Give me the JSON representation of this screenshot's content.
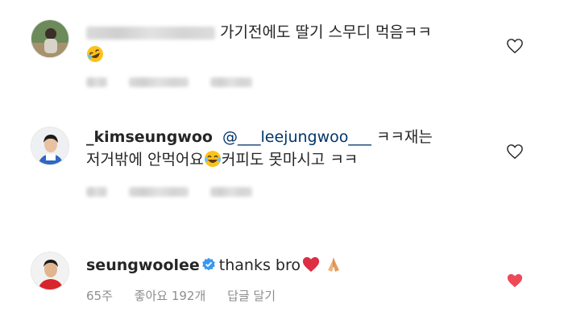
{
  "comments": [
    {
      "username": "",
      "text_line1": "가기전에도 딸기 스무디 먹음ㅋㅋ",
      "emoji": "rolling-on-floor-laughing",
      "time": "",
      "likes": "",
      "reply": "",
      "liked": false
    },
    {
      "username": "_kimseungwoo",
      "mention": "@___leejungwoo___",
      "text_line1": " ㅋㅋ재는",
      "text_line2a": "저거밖에 안먹어요",
      "emoji": "face-with-tears-of-joy",
      "text_line2b": "커피도 못마시고 ㅋㅋ",
      "time": "",
      "likes": "",
      "reply": "",
      "liked": false
    },
    {
      "username": "seungwoolee",
      "verified": true,
      "text": "thanks bro",
      "emojis": [
        "red-heart",
        "folded-hands"
      ],
      "time": "65주",
      "likes": "좋아요 192개",
      "reply": "답글 달기",
      "liked": true
    }
  ],
  "colors": {
    "text": "#262626",
    "meta": "#8e8e8e",
    "mention": "#003569",
    "verified": "#3897f0",
    "liked_heart": "#ed4956"
  }
}
